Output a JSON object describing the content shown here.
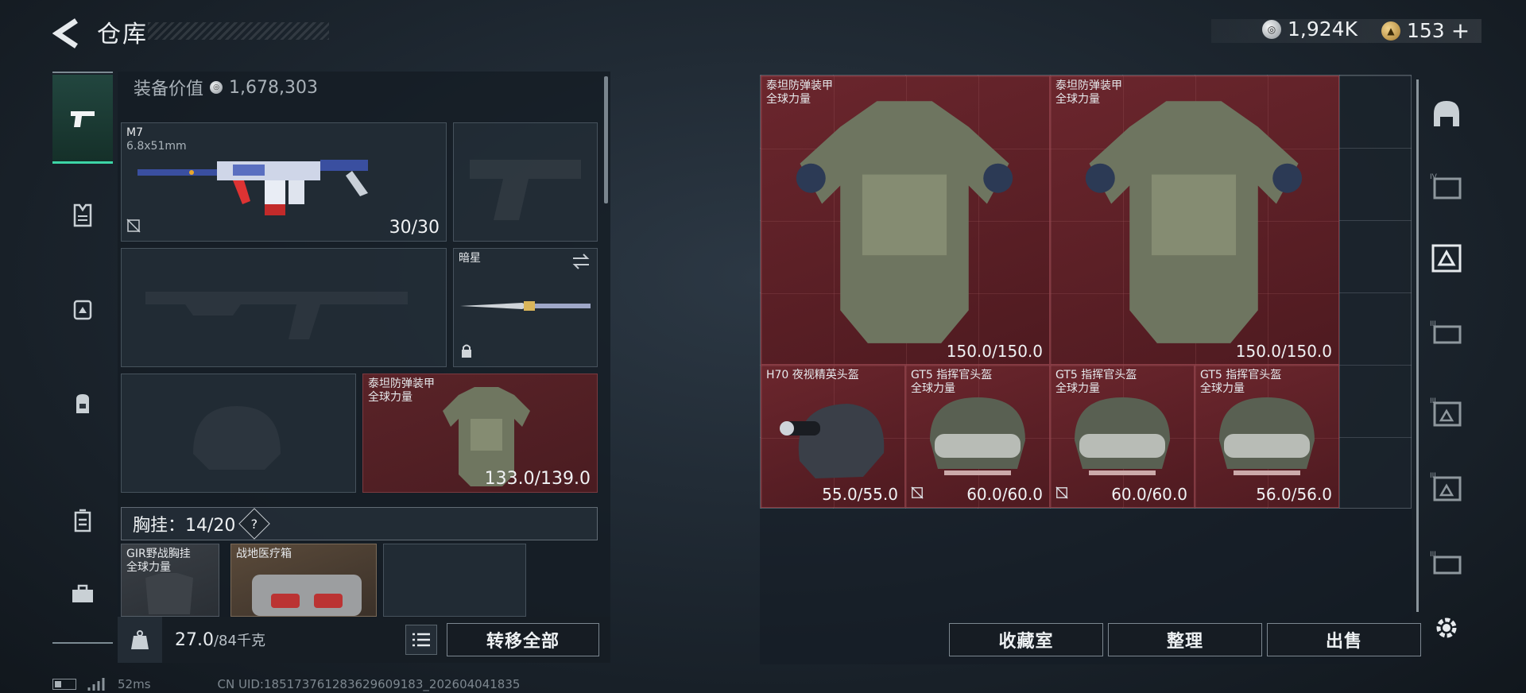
{
  "header": {
    "title": "仓库"
  },
  "currency": [
    {
      "icon": "silver-coin-icon",
      "value": "1,924K"
    },
    {
      "icon": "gold-coin-icon",
      "value": "153",
      "suffix": "+"
    }
  ],
  "left_nav": {
    "items": [
      "pistol-icon",
      "vest-icon",
      "rig-icon",
      "backpack-icon",
      "case-icon",
      "toolbox-icon"
    ],
    "active_index": 0
  },
  "equip_value": {
    "label": "装备价值",
    "value": "1,678,303"
  },
  "loadout": {
    "primary": {
      "name": "M7",
      "caliber": "6.8x51mm",
      "ammo": "30/30"
    },
    "melee": {
      "name": "暗星"
    },
    "armor": {
      "name": "泰坦防弹装甲",
      "sub": "全球力量",
      "durability": "133.0/139.0"
    }
  },
  "chest_rig": {
    "label": "胸挂：14/20",
    "help": "?"
  },
  "rig_items": [
    {
      "name": "GIR野战胸挂",
      "sub": "全球力量"
    },
    {
      "name": "战地医疗箱"
    }
  ],
  "bottom": {
    "weight": "27.0",
    "capacity": "/84千克",
    "kg_label": "KG",
    "transfer_all": "转移全部"
  },
  "stash": {
    "items": [
      {
        "name": "泰坦防弹装甲",
        "sub": "全球力量",
        "durability": "150.0/150.0"
      },
      {
        "name": "泰坦防弹装甲",
        "sub": "全球力量",
        "durability": "150.0/150.0"
      },
      {
        "name": "H70 夜视精英头盔",
        "sub": "",
        "durability": "55.0/55.0"
      },
      {
        "name": "GT5 指挥官头盔",
        "sub": "全球力量",
        "durability": "60.0/60.0"
      },
      {
        "name": "GT5 指挥官头盔",
        "sub": "全球力量",
        "durability": "60.0/60.0"
      },
      {
        "name": "GT5 指挥官头盔",
        "sub": "全球力量",
        "durability": "56.0/56.0"
      }
    ]
  },
  "actions": {
    "collection": "收藏室",
    "sort": "整理",
    "sell": "出售"
  },
  "right_rail": [
    "helmet-icon",
    "case-iv-icon",
    "armor-grid-icon",
    "case-iii-icon",
    "case-iii-icon",
    "case-iii-icon",
    "case-iii-icon"
  ],
  "footer": {
    "ping": "52ms",
    "uid": "CN UID:185173761283629609183_202604041835"
  },
  "colors": {
    "accent": "#3dd5a6",
    "item_bg": "#5a2328"
  }
}
